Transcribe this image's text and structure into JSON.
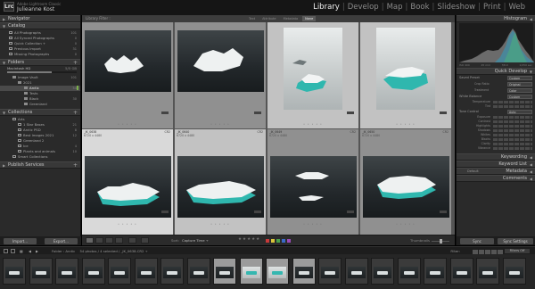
{
  "identity": {
    "app_name": "Adobe Lightroom Classic",
    "user_name": "Julieanne Kost",
    "logo": "Lrc"
  },
  "modules": [
    "Library",
    "Develop",
    "Map",
    "Book",
    "Slideshow",
    "Print",
    "Web"
  ],
  "active_module": "Library",
  "left": {
    "navigator": "Navigator",
    "catalog": {
      "title": "Catalog",
      "items": [
        {
          "label": "All Photographs",
          "count": "101"
        },
        {
          "label": "All Synced Photographs",
          "count": "0"
        },
        {
          "label": "Quick Collection +",
          "count": "0"
        },
        {
          "label": "Previous Import",
          "count": "31"
        },
        {
          "label": "Missing Photographs",
          "count": "0"
        }
      ]
    },
    "folders": {
      "title": "Folders",
      "drive": "Macintosh HD",
      "drive_space": "5/5 GB",
      "items": [
        {
          "label": "Image Vault",
          "count": "101",
          "depth": 1
        },
        {
          "label": "2021",
          "count": "",
          "depth": 2
        },
        {
          "label": "Arctic",
          "count": "54",
          "depth": 3,
          "selected": true
        },
        {
          "label": "Tests",
          "count": "",
          "depth": 3
        },
        {
          "label": "Black",
          "count": "30",
          "depth": 3
        },
        {
          "label": "Greenland",
          "count": "",
          "depth": 3
        }
      ]
    },
    "collections": {
      "title": "Collections",
      "items": [
        {
          "label": "Arts",
          "count": "",
          "depth": 1
        },
        {
          "label": "1 Star Bases",
          "count": "21",
          "depth": 2
        },
        {
          "label": "Arctic PSD",
          "count": "8",
          "depth": 2
        },
        {
          "label": "Best Images 2021",
          "count": "12",
          "depth": 2
        },
        {
          "label": "Greenland 2",
          "count": "",
          "depth": 2
        },
        {
          "label": "Ice",
          "count": "4",
          "depth": 2
        },
        {
          "label": "Plants and animals",
          "count": "10",
          "depth": 2
        },
        {
          "label": "Smart Collections",
          "count": "",
          "depth": 1
        }
      ]
    },
    "publish": "Publish Services",
    "import_btn": "Import...",
    "export_btn": "Export..."
  },
  "center": {
    "filter_title": "Library Filter :",
    "filter_tabs": [
      "Text",
      "Attribute",
      "Metadata",
      "None"
    ],
    "active_filter": "None",
    "cells": [
      {
        "name": "",
        "meta": "",
        "num": "",
        "kind": "land",
        "state": ""
      },
      {
        "name": "",
        "meta": "",
        "num": "",
        "kind": "land",
        "state": ""
      },
      {
        "name": "",
        "meta": "",
        "num": "",
        "kind": "tall",
        "state": "sel2"
      },
      {
        "name": "",
        "meta": "",
        "num": "",
        "kind": "tall",
        "state": "sel2"
      },
      {
        "name": "_JK_0638",
        "meta": "6720 x 4480",
        "num": "CR2",
        "kind": "land",
        "state": "sel"
      },
      {
        "name": "_JK_0640",
        "meta": "6720 x 4480",
        "num": "CR2",
        "kind": "land",
        "state": "sel2"
      },
      {
        "name": "_JK_0649",
        "meta": "6720 x 4480",
        "num": "CR2",
        "kind": "land",
        "state": ""
      },
      {
        "name": "_JK_0650",
        "meta": "6720 x 4480",
        "num": "CR2",
        "kind": "land",
        "state": ""
      }
    ]
  },
  "toolbar": {
    "sort_label": "Sort:",
    "sort_value": "Capture Time ÷",
    "stars": "★★★★★",
    "thumbnails_label": "Thumbnails"
  },
  "right": {
    "histogram": "Histogram",
    "histo_vals": [
      "ISO 400",
      "45 mm",
      "f/8.0",
      "1/250 sec"
    ],
    "quick_develop": "Quick Develop",
    "saved_preset_label": "Saved Preset",
    "saved_preset_value": "Custom",
    "crop_ratio_label": "Crop Ratio",
    "crop_ratio_value": "Original",
    "treatment_label": "Treatment",
    "treatment_value": "Color",
    "white_balance_label": "White Balance",
    "white_balance_value": "Custom",
    "temperature_label": "Temperature",
    "tint_label": "Tint",
    "tone_control_label": "Tone Control",
    "tone_control_value": "Auto",
    "tone_rows": [
      "Exposure",
      "Contrast",
      "Highlights",
      "Shadows",
      "Whites",
      "Blacks",
      "Clarity",
      "Vibrance"
    ],
    "keywording": "Keywording",
    "keyword_list": "Keyword List",
    "metadata": "Metadata",
    "metadata_preset": "Default",
    "comments": "Comments",
    "sync_btn": "Sync",
    "sync_settings_btn": "Sync Settings"
  },
  "filmstrip": {
    "path": "Folder : Arctic",
    "info": "54 photos / 4 selected / _JK_0638.CR2 ÷",
    "filter_label": "Filter:",
    "filter_value": "Filters Off",
    "thumb_count": 20
  },
  "colors": {
    "accent_green": "#7bb04a",
    "label_red": "#c83a3a",
    "label_yellow": "#d8c43a",
    "label_green": "#4aa04a",
    "label_blue": "#3a6ac8",
    "label_purple": "#9a4ab8"
  }
}
